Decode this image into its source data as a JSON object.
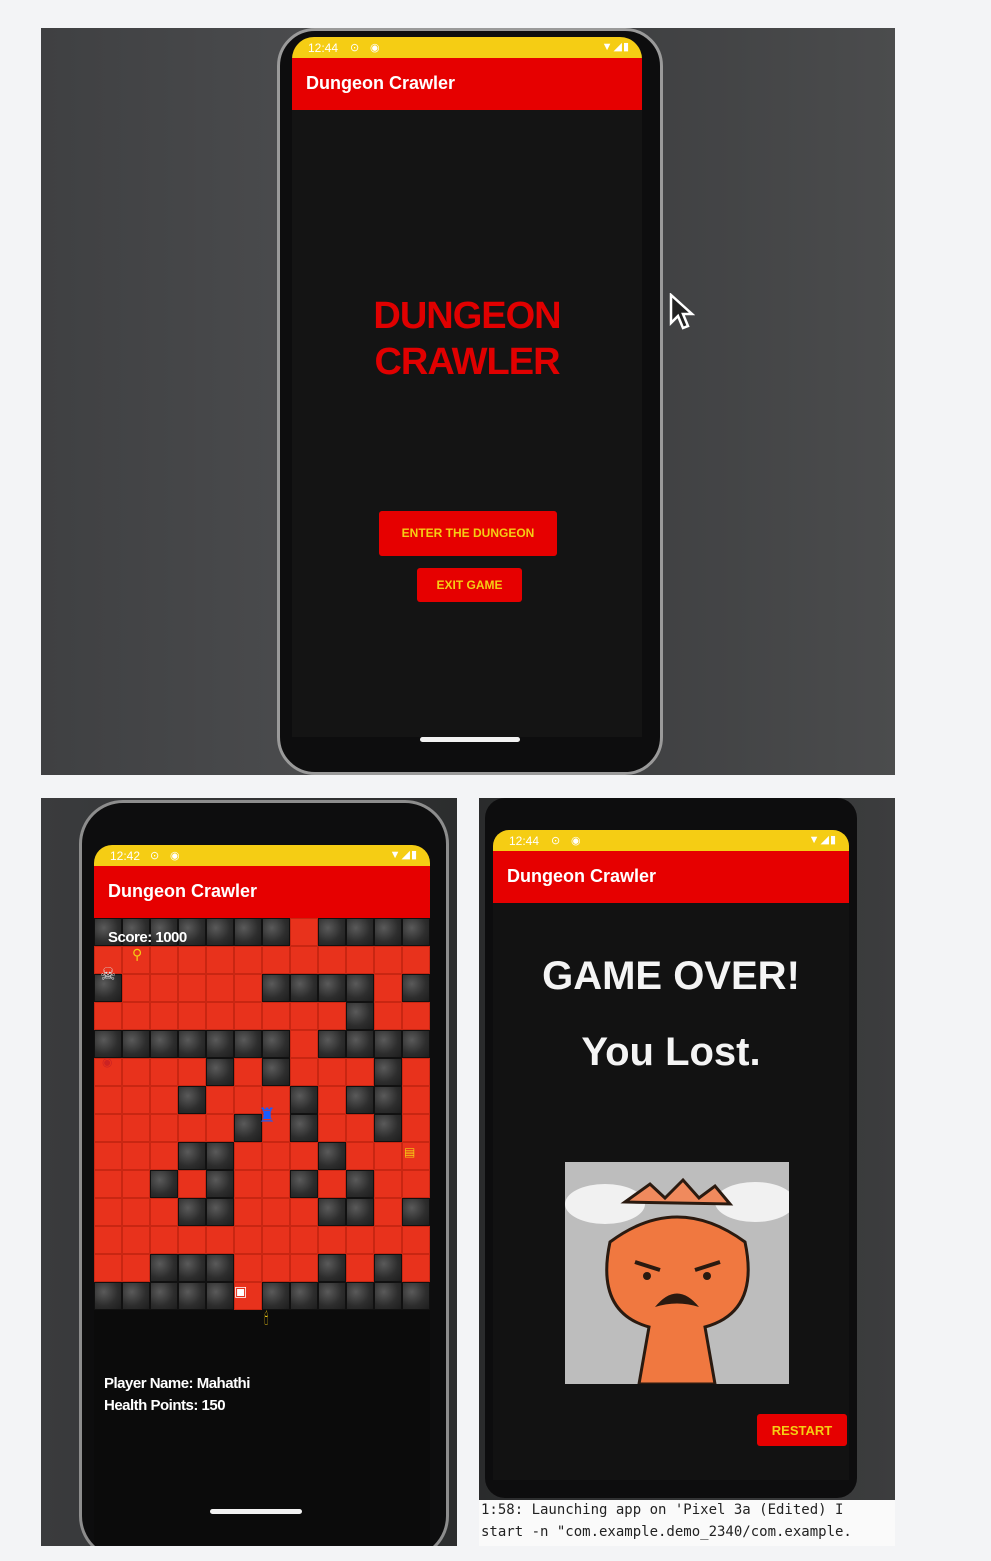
{
  "app": {
    "title": "Dungeon Crawler",
    "accent_red": "#e60000",
    "status_yellow": "#f5cd14"
  },
  "top_phone": {
    "status_time": "12:44",
    "status_icons_left": [
      "sync-icon",
      "circle-icon"
    ],
    "status_icons_right": [
      "wifi-icon",
      "signal-icon",
      "battery-icon"
    ],
    "headline_line1": "DUNGEON",
    "headline_line2": "CRAWLER",
    "enter_button": "ENTER THE DUNGEON",
    "exit_button": "EXIT GAME"
  },
  "game_phone": {
    "status_time": "12:42",
    "score_text": "Score: 1000",
    "player_name_text": "Player Name: Mahathi",
    "health_text": "Health Points: 150",
    "grid_rows": [
      "wwwwwwwfwwww",
      "ffffffffffff",
      "wfffffwwwwfw",
      "fffffffffwff",
      "wwwwwwwfwwww",
      "ffffwfwfffwf",
      "fffwfffwfwwf",
      "fffffwfwffwf",
      "fffwwfffwfff",
      "ffwfwffwfwff",
      "fffwwfffwwfw",
      "ffffffffffff",
      "ffwwwfffwfwf",
      "wwwwwfwwwwww"
    ]
  },
  "gameover_phone": {
    "status_time": "12:44",
    "line1": "GAME OVER!",
    "line2": "You Lost.",
    "restart_button": "RESTART"
  },
  "ide_log": {
    "line1": "1:58: Launching app on 'Pixel 3a (Edited) I",
    "line2": "start -n \"com.example.demo_2340/com.example."
  }
}
